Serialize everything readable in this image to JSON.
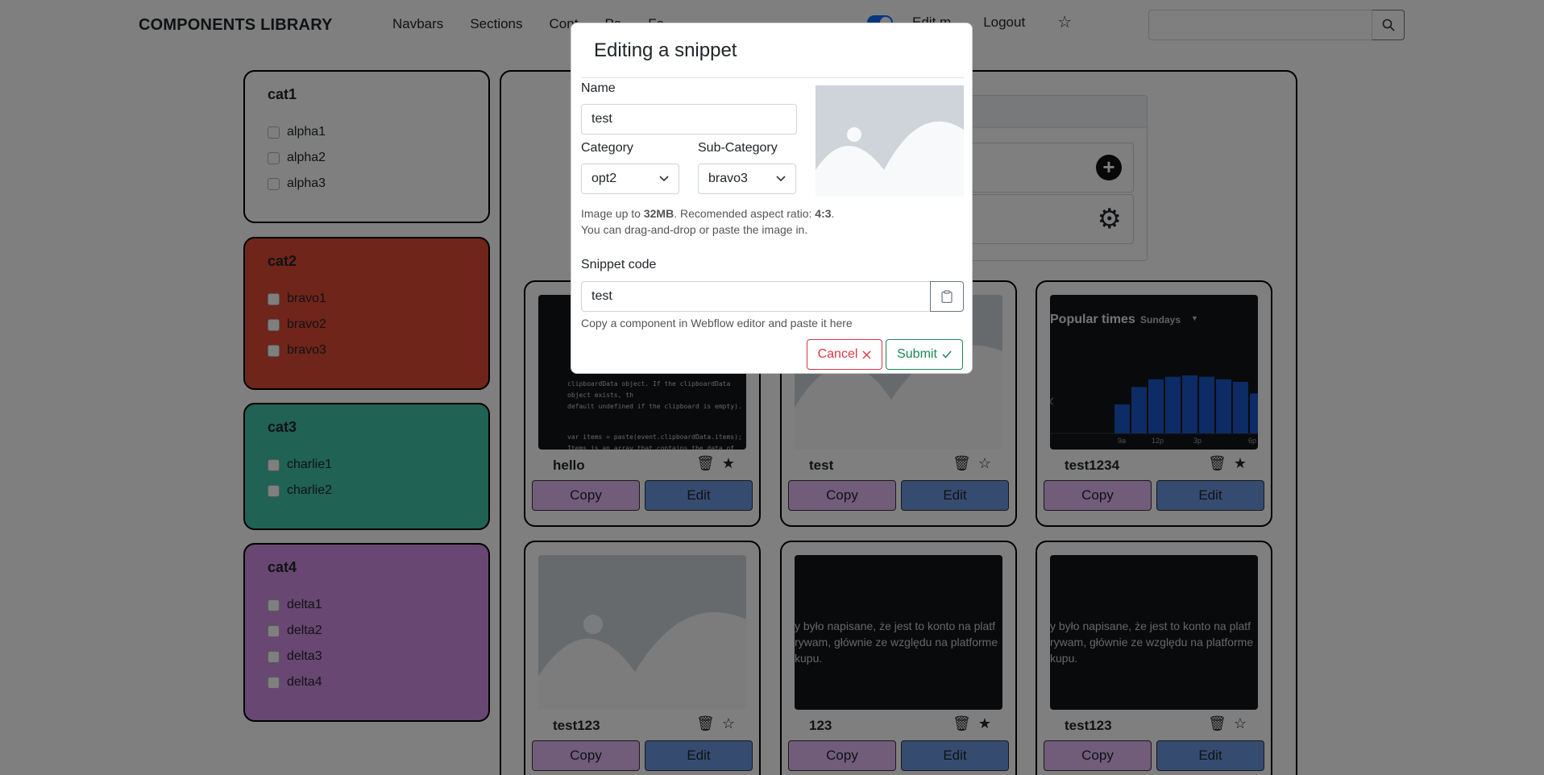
{
  "nav": {
    "brand": "COMPONENTS LIBRARY",
    "links": [
      "Navbars",
      "Sections",
      "Cont",
      "Pa",
      "Fo"
    ],
    "edit_label": "Edit m",
    "logout": "Logout"
  },
  "categories": [
    {
      "title": "cat1",
      "color": "#ffffff",
      "items": [
        "alpha1",
        "alpha2",
        "alpha3"
      ]
    },
    {
      "title": "cat2",
      "color": "#e04a35",
      "items": [
        "bravo1",
        "bravo2",
        "bravo3"
      ]
    },
    {
      "title": "cat3",
      "color": "#40c4a8",
      "items": [
        "charlie1",
        "charlie2"
      ]
    },
    {
      "title": "cat4",
      "color": "#d08fe4",
      "items": [
        "delta1",
        "delta2",
        "delta3",
        "delta4"
      ]
    }
  ],
  "cards": [
    {
      "title": "hello",
      "fav": true,
      "copy": "Copy",
      "edit": "Edit",
      "code_lines": [
        "clipboardData object. If the clipboardData object exists, th",
        "default undefined if the clipboard is empty).",
        "var items = paste(event.clipboardData.items);",
        "Items is an array that contains the data of the clipboard"
      ]
    },
    {
      "title": "test",
      "fav": false,
      "copy": "Copy",
      "edit": "Edit"
    },
    {
      "title": "test1234",
      "fav": true,
      "copy": "Copy",
      "edit": "Edit",
      "chart": {
        "title": "Popular times",
        "day": "Sundays",
        "ticks": [
          "9a",
          "12p",
          "3p",
          "6p"
        ],
        "values": [
          0.45,
          0.72,
          0.84,
          0.88,
          0.9,
          0.88,
          0.84,
          0.8,
          0.62
        ]
      }
    },
    {
      "title": "test123",
      "fav": false,
      "copy": "Copy",
      "edit": "Edit"
    },
    {
      "title": "123",
      "fav": true,
      "copy": "Copy",
      "edit": "Edit",
      "text_lines": [
        "y było napisane, że jest to konto na platf",
        "rywam, głównie ze względu na platforme",
        "kupu."
      ]
    },
    {
      "title": "test123",
      "fav": false,
      "copy": "Copy",
      "edit": "Edit",
      "text_lines": [
        "y było napisane, że jest to konto na platf",
        "rywam, głównie ze względu na platforme",
        "kupu."
      ]
    }
  ],
  "modal": {
    "title": "Editing a snippet",
    "name_label": "Name",
    "name_value": "test",
    "category_label": "Category",
    "category_value": "opt2",
    "subcategory_label": "Sub-Category",
    "subcategory_value": "bravo3",
    "help1_pre": "Image up to ",
    "help1_b1": "32MB",
    "help1_mid": ". Recomended aspect ratio: ",
    "help1_b2": "4:3",
    "help1_end": ".",
    "help2": "You can drag-and-drop or paste the image in.",
    "code_label": "Snippet code",
    "code_value": "test",
    "code_help": "Copy a component in Webflow editor and paste it here",
    "cancel": "Cancel",
    "submit": "Submit",
    "cancel_color": "#dc3545",
    "submit_color": "#198754"
  }
}
